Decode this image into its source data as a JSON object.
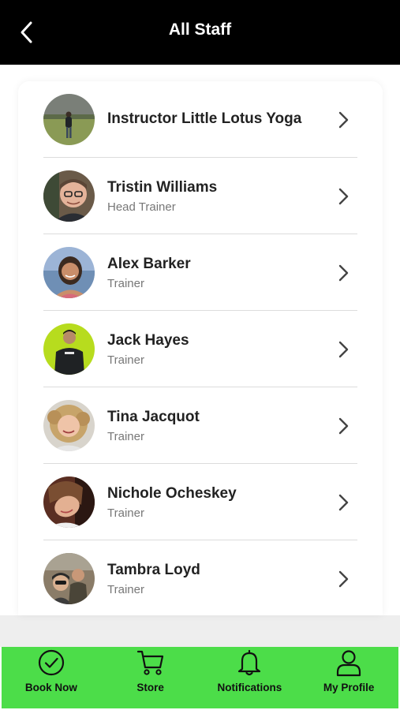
{
  "header": {
    "title": "All Staff"
  },
  "staff": [
    {
      "name": "Instructor Little Lotus Yoga",
      "role": "",
      "avatar_icon": "avatar-person-field"
    },
    {
      "name": "Tristin Williams",
      "role": "Head Trainer",
      "avatar_icon": "avatar-man-glasses"
    },
    {
      "name": "Alex Barker",
      "role": "Trainer",
      "avatar_icon": "avatar-woman-beach"
    },
    {
      "name": "Jack Hayes",
      "role": "Trainer",
      "avatar_icon": "avatar-man-lime"
    },
    {
      "name": "Tina Jacquot",
      "role": "Trainer",
      "avatar_icon": "avatar-woman-curly"
    },
    {
      "name": "Nichole Ocheskey",
      "role": "Trainer",
      "avatar_icon": "avatar-woman-selfie"
    },
    {
      "name": "Tambra Loyd",
      "role": "Trainer",
      "avatar_icon": "avatar-group-outdoor"
    }
  ],
  "tabbar": {
    "book_now": "Book Now",
    "store": "Store",
    "notifications": "Notifications",
    "my_profile": "My Profile"
  },
  "colors": {
    "header_bg": "#000000",
    "tabbar_bg": "#4cdd49",
    "name_text": "#222222",
    "role_text": "#777777"
  }
}
